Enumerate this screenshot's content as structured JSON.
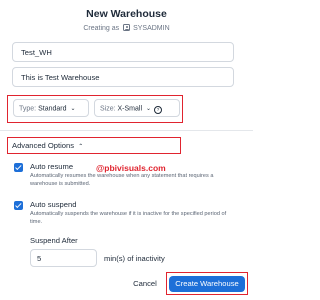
{
  "dialog": {
    "title": "New Warehouse",
    "subtitle_prefix": "Creating as",
    "creator": "SYSADMIN"
  },
  "fields": {
    "name_value": "Test_WH",
    "comment_value": "This is Test Warehouse"
  },
  "type_select": {
    "label": "Type:",
    "value": "Standard"
  },
  "size_select": {
    "label": "Size:",
    "value": "X-Small"
  },
  "advanced": {
    "label": "Advanced Options",
    "expanded": true
  },
  "auto_resume": {
    "checked": true,
    "title": "Auto resume",
    "description": "Automatically resumes the warehouse when any statement that requires a warehouse is submitted."
  },
  "auto_suspend": {
    "checked": true,
    "title": "Auto suspend",
    "description": "Automatically suspends the warehouse if it is inactive for the specified period of time."
  },
  "suspend_after": {
    "label": "Suspend After",
    "value": "5",
    "unit": "min(s) of inactivity"
  },
  "watermark": "@pbivisuals.com",
  "buttons": {
    "cancel": "Cancel",
    "create": "Create Warehouse"
  },
  "icons": {
    "creator": "user-badge-icon",
    "type_chevron": "chevron-down-icon",
    "size_chevron": "chevron-down-icon",
    "size_help": "help-circle-icon",
    "advanced_chevron": "chevron-up-icon",
    "checkbox": "checkmark-icon"
  },
  "colors": {
    "primary": "#1d6fd8",
    "highlight_annotation": "#e0242f",
    "watermark": "#e0242f",
    "text": "#1e2a39",
    "muted": "#6b7585",
    "border": "#d3d8df"
  }
}
